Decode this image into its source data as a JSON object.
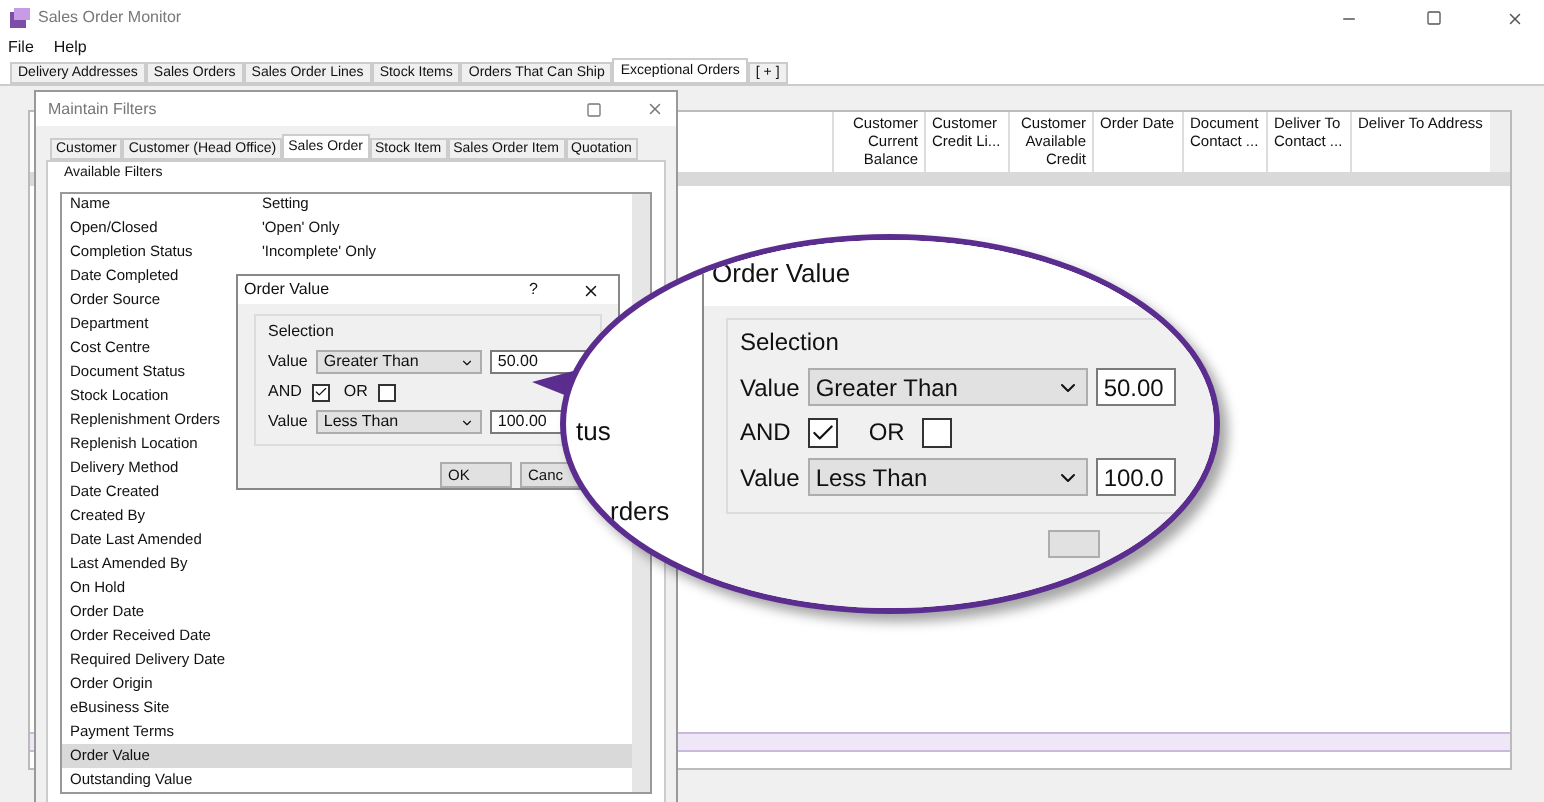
{
  "window": {
    "title": "Sales Order Monitor"
  },
  "menu": [
    "File",
    "Help"
  ],
  "tabs": [
    {
      "label": "Delivery Addresses",
      "selected": false
    },
    {
      "label": "Sales Orders",
      "selected": false
    },
    {
      "label": "Sales Order Lines",
      "selected": false
    },
    {
      "label": "Stock Items",
      "selected": false
    },
    {
      "label": "Orders That Can Ship",
      "selected": false
    },
    {
      "label": "Exceptional Orders",
      "selected": true
    }
  ],
  "add_tab": "[ + ]",
  "grid": {
    "columns": [
      {
        "label": "Customer Current Balance",
        "kind": "numeric"
      },
      {
        "label": "Customer Credit Li...",
        "kind": "text"
      },
      {
        "label": "Customer Available Credit",
        "kind": "numeric"
      },
      {
        "label": "Order Date",
        "kind": "text"
      },
      {
        "label": "Document Contact ...",
        "kind": "text"
      },
      {
        "label": "Deliver To Contact ...",
        "kind": "text"
      },
      {
        "label": "Deliver To Address",
        "kind": "text"
      }
    ]
  },
  "filters_dialog": {
    "title": "Maintain Filters",
    "tabs": [
      {
        "label": "Customer",
        "selected": false
      },
      {
        "label": "Customer (Head Office)",
        "selected": false
      },
      {
        "label": "Sales Order",
        "selected": true
      },
      {
        "label": "Stock Item",
        "selected": false
      },
      {
        "label": "Sales Order Item",
        "selected": false
      },
      {
        "label": "Quotation",
        "selected": false
      }
    ],
    "group": "Available Filters",
    "columns": [
      "Name",
      "Setting"
    ],
    "rows": [
      {
        "name": "Open/Closed",
        "setting": "'Open' Only",
        "selected": false
      },
      {
        "name": "Completion Status",
        "setting": "'Incomplete' Only",
        "selected": false
      },
      {
        "name": "Date Completed",
        "selected": false
      },
      {
        "name": "Order Source",
        "selected": false
      },
      {
        "name": "Department",
        "selected": false
      },
      {
        "name": "Cost Centre",
        "selected": false
      },
      {
        "name": "Document Status",
        "selected": false
      },
      {
        "name": "Stock Location",
        "selected": false
      },
      {
        "name": "Replenishment Orders",
        "selected": false
      },
      {
        "name": "Replenish Location",
        "selected": false
      },
      {
        "name": "Delivery Method",
        "selected": false
      },
      {
        "name": "Date Created",
        "selected": false
      },
      {
        "name": "Created By",
        "selected": false
      },
      {
        "name": "Date Last Amended",
        "selected": false
      },
      {
        "name": "Last Amended By",
        "selected": false
      },
      {
        "name": "On Hold",
        "selected": false
      },
      {
        "name": "Order Date",
        "selected": false
      },
      {
        "name": "Order Received Date",
        "selected": false
      },
      {
        "name": "Required Delivery Date",
        "selected": false
      },
      {
        "name": "Order Origin",
        "selected": false
      },
      {
        "name": "eBusiness Site",
        "selected": false
      },
      {
        "name": "Payment Terms",
        "selected": false
      },
      {
        "name": "Order Value",
        "selected": true
      },
      {
        "name": "Outstanding Value",
        "selected": false
      }
    ]
  },
  "order_value_dialog": {
    "title": "Order Value",
    "help": "?",
    "group": "Selection",
    "value_label_1": "Value",
    "operator_1": "Greater Than",
    "amount_1": "50.00",
    "and_label": "AND",
    "and_checked": true,
    "or_label": "OR",
    "or_checked": false,
    "value_label_2": "Value",
    "operator_2": "Less Than",
    "amount_2": "100.00",
    "buttons": [
      "OK",
      "Canc"
    ]
  },
  "magnifier": {
    "fragments": [
      "tus",
      "rders"
    ],
    "title": "Order Value",
    "group": "Selection",
    "value_label_1": "Value",
    "operator_1": "Greater Than",
    "amount_1": "50.00",
    "and_label": "AND",
    "and_checked": true,
    "or_label": "OR",
    "or_checked": false,
    "value_label_2": "Value",
    "operator_2": "Less Than",
    "amount_2": "100.0"
  }
}
